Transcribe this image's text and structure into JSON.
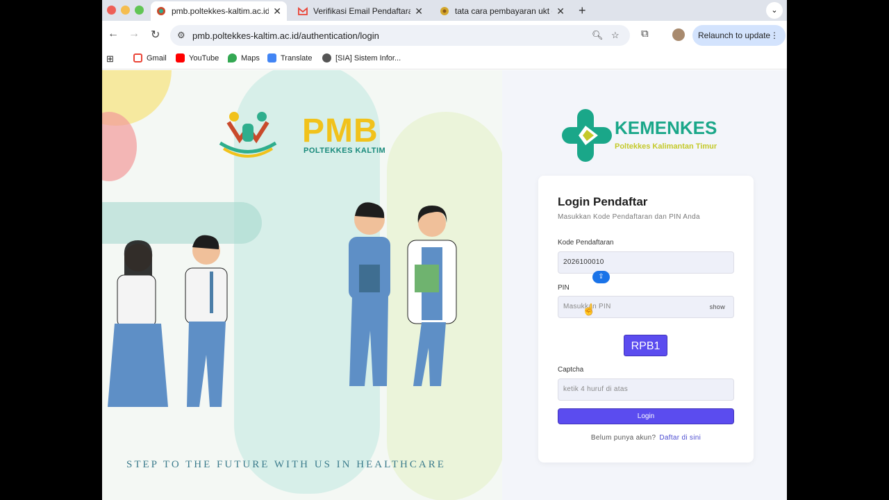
{
  "tabs": [
    {
      "title": "pmb.poltekkes-kaltim.ac.id/au",
      "active": true,
      "favicon": "poltekkes-favicon"
    },
    {
      "title": "Verifikasi Email Pendaftaran -",
      "active": false,
      "favicon": "gmail-favicon"
    },
    {
      "title": "tata cara pembayaran ukt dan",
      "active": false,
      "favicon": "poltekkes-favicon"
    }
  ],
  "toolbar": {
    "url": "pmb.poltekkes-kaltim.ac.id/authentication/login",
    "relaunch_label": "Relaunch to update"
  },
  "bookmarks": [
    {
      "label": "Gmail",
      "color": "#ea4335"
    },
    {
      "label": "YouTube",
      "color": "#ff0000"
    },
    {
      "label": "Maps",
      "color": "#34a853"
    },
    {
      "label": "Translate",
      "color": "#4285f4"
    },
    {
      "label": "[SIA] Sistem Infor...",
      "color": "#555555"
    }
  ],
  "hero": {
    "pmb_title": "PMB",
    "pmb_subtitle": "POLTEKKES KALTIM",
    "tagline": "STEP TO THE FUTURE WITH US IN HEALTHCARE"
  },
  "brand": {
    "name": "KEMENKES",
    "subtitle": "Poltekkes Kalimantan Timur"
  },
  "login": {
    "title": "Login Pendaftar",
    "subtitle": "Masukkan Kode Pendaftaran dan PIN Anda",
    "kode_label": "Kode Pendaftaran",
    "kode_value": "2026100010",
    "pin_label": "PIN",
    "pin_placeholder": "Masukkan PIN",
    "show_label": "show",
    "captcha_text": "RPB1",
    "captcha_label": "Captcha",
    "captcha_placeholder": "ketik 4 huruf di atas",
    "login_button": "Login",
    "footer_text": "Belum punya akun?",
    "footer_link": "Daftar di sini"
  },
  "colors": {
    "accent": "#5b4cef",
    "brand_green": "#1aa789",
    "pmb_yellow": "#f1c21b"
  }
}
